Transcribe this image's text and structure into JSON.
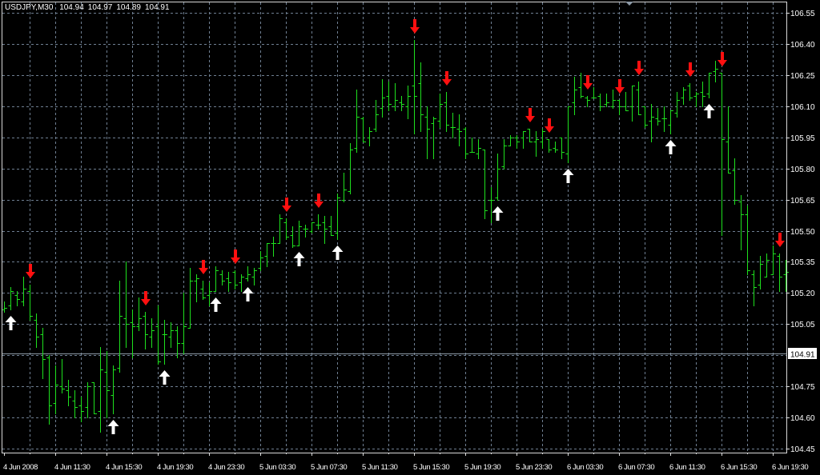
{
  "header": {
    "symbol": "USDJPY,M30",
    "open": "104.94",
    "high": "104.97",
    "low": "104.89",
    "close": "104.91"
  },
  "colors": {
    "background": "#000000",
    "grid": "#6f7f92",
    "bar": "#1ee01e",
    "sell_arrow": "#ff1010",
    "buy_arrow": "#ffffff",
    "current_price_line": "#8c99a6"
  },
  "chart_data": {
    "type": "ohlc",
    "title": "USDJPY,M30",
    "ylim": [
      104.45,
      106.55
    ],
    "grid": true,
    "current_price": 104.91,
    "current_price_label": "104.91",
    "price_ticks": [
      "106.55",
      "106.40",
      "106.25",
      "106.10",
      "105.95",
      "105.80",
      "105.65",
      "105.50",
      "105.35",
      "105.20",
      "105.05",
      "104.75",
      "104.60",
      "104.45"
    ],
    "time_labels": [
      "4 Jun 2008",
      "4 Jun 11:30",
      "4 Jun 15:30",
      "4 Jun 19:30",
      "4 Jun 23:30",
      "5 Jun 03:30",
      "5 Jun 07:30",
      "5 Jun 11:30",
      "5 Jun 15:30",
      "5 Jun 19:30",
      "5 Jun 23:30",
      "6 Jun 03:30",
      "6 Jun 07:30",
      "6 Jun 11:30",
      "6 Jun 15:30",
      "6 Jun 19:30"
    ],
    "bars_ohlc": [
      [
        105.12,
        105.16,
        105.11,
        105.13
      ],
      [
        105.14,
        105.23,
        105.12,
        105.21
      ],
      [
        105.19,
        105.21,
        105.14,
        105.17
      ],
      [
        105.16,
        105.28,
        105.14,
        105.22
      ],
      [
        105.21,
        105.24,
        105.07,
        105.09
      ],
      [
        105.07,
        105.1,
        104.94,
        104.99
      ],
      [
        105.0,
        105.03,
        104.79,
        104.88
      ],
      [
        104.89,
        104.9,
        104.57,
        104.66
      ],
      [
        104.67,
        104.85,
        104.62,
        104.76
      ],
      [
        104.75,
        104.88,
        104.72,
        104.74
      ],
      [
        104.73,
        104.78,
        104.66,
        104.7
      ],
      [
        104.68,
        104.73,
        104.6,
        104.65
      ],
      [
        104.66,
        104.7,
        104.58,
        104.63
      ],
      [
        104.65,
        104.77,
        104.6,
        104.75
      ],
      [
        104.77,
        104.77,
        104.62,
        104.62
      ],
      [
        104.63,
        104.94,
        104.53,
        104.83
      ],
      [
        104.82,
        104.92,
        104.6,
        104.73
      ],
      [
        104.71,
        104.85,
        104.62,
        104.83
      ],
      [
        104.84,
        105.26,
        104.82,
        105.09
      ],
      [
        105.08,
        105.35,
        104.94,
        105.05
      ],
      [
        105.06,
        105.12,
        104.89,
        105.04
      ],
      [
        105.04,
        105.18,
        105.02,
        105.08
      ],
      [
        105.09,
        105.11,
        104.93,
        105.0
      ],
      [
        104.99,
        105.08,
        104.94,
        105.02
      ],
      [
        105.04,
        105.14,
        104.86,
        104.87
      ],
      [
        105.0,
        105.07,
        104.86,
        105.0
      ],
      [
        104.99,
        105.06,
        104.94,
        105.02
      ],
      [
        105.02,
        105.04,
        104.89,
        104.96
      ],
      [
        104.96,
        105.2,
        104.91,
        105.04
      ],
      [
        105.03,
        105.32,
        105.03,
        105.26
      ],
      [
        105.26,
        105.29,
        105.16,
        105.27
      ],
      [
        105.22,
        105.26,
        105.17,
        105.18
      ],
      [
        105.19,
        105.25,
        105.14,
        105.21
      ],
      [
        105.21,
        105.33,
        105.21,
        105.31
      ],
      [
        105.29,
        105.31,
        105.24,
        105.26
      ],
      [
        105.27,
        105.3,
        105.21,
        105.25
      ],
      [
        105.3,
        105.31,
        105.22,
        105.24
      ],
      [
        105.25,
        105.29,
        105.21,
        105.28
      ],
      [
        105.27,
        105.33,
        105.26,
        105.29
      ],
      [
        105.28,
        105.32,
        105.24,
        105.31
      ],
      [
        105.32,
        105.4,
        105.31,
        105.37
      ],
      [
        105.38,
        105.44,
        105.33,
        105.44
      ],
      [
        105.44,
        105.47,
        105.38,
        105.44
      ],
      [
        105.44,
        105.58,
        105.44,
        105.56
      ],
      [
        105.54,
        105.56,
        105.46,
        105.47
      ],
      [
        105.48,
        105.52,
        105.42,
        105.43
      ],
      [
        105.43,
        105.55,
        105.43,
        105.52
      ],
      [
        105.51,
        105.53,
        105.47,
        105.51
      ],
      [
        105.5,
        105.54,
        105.49,
        105.54
      ],
      [
        105.53,
        105.58,
        105.51,
        105.53
      ],
      [
        105.54,
        105.57,
        105.44,
        105.51
      ],
      [
        105.52,
        105.57,
        105.48,
        105.48
      ],
      [
        105.49,
        105.68,
        105.46,
        105.66
      ],
      [
        105.65,
        105.78,
        105.64,
        105.7
      ],
      [
        105.69,
        105.92,
        105.68,
        105.89
      ],
      [
        105.9,
        106.18,
        105.88,
        106.05
      ],
      [
        106.04,
        106.05,
        105.93,
        105.93
      ],
      [
        105.95,
        106.0,
        105.91,
        105.98
      ],
      [
        105.99,
        106.13,
        105.98,
        106.06
      ],
      [
        106.09,
        106.23,
        106.05,
        106.14
      ],
      [
        106.15,
        106.22,
        106.08,
        106.11
      ],
      [
        106.1,
        106.21,
        106.08,
        106.13
      ],
      [
        106.12,
        106.15,
        106.08,
        106.11
      ],
      [
        106.1,
        106.2,
        106.04,
        106.15
      ],
      [
        106.2,
        106.42,
        105.97,
        106.15
      ],
      [
        106.21,
        106.31,
        105.98,
        106.06
      ],
      [
        106.05,
        106.1,
        105.85,
        105.99
      ],
      [
        106.02,
        106.05,
        105.85,
        106.04
      ],
      [
        106.03,
        106.16,
        106.0,
        106.11
      ],
      [
        106.12,
        106.17,
        105.98,
        106.01
      ],
      [
        106.0,
        106.07,
        105.95,
        106.0
      ],
      [
        105.99,
        106.06,
        105.91,
        105.98
      ],
      [
        105.99,
        106.0,
        105.85,
        105.87
      ],
      [
        105.88,
        105.95,
        105.88,
        105.88
      ],
      [
        105.87,
        105.94,
        105.85,
        105.9
      ],
      [
        105.89,
        105.89,
        105.56,
        105.6
      ],
      [
        105.65,
        105.71,
        105.54,
        105.65
      ],
      [
        105.66,
        105.87,
        105.65,
        105.8
      ],
      [
        105.81,
        105.94,
        105.8,
        105.91
      ],
      [
        105.91,
        105.96,
        105.91,
        105.95
      ],
      [
        105.95,
        105.96,
        105.9,
        105.93
      ],
      [
        105.95,
        105.98,
        105.9,
        105.98
      ],
      [
        105.99,
        105.99,
        105.93,
        105.93
      ],
      [
        105.93,
        105.98,
        105.86,
        105.94
      ],
      [
        105.93,
        105.99,
        105.9,
        105.98
      ],
      [
        105.94,
        105.94,
        105.88,
        105.89
      ],
      [
        105.9,
        105.93,
        105.88,
        105.89
      ],
      [
        105.95,
        105.95,
        105.85,
        105.88
      ],
      [
        105.87,
        106.1,
        105.83,
        106.1
      ],
      [
        106.12,
        106.24,
        106.06,
        106.18
      ],
      [
        106.19,
        106.26,
        106.14,
        106.15
      ],
      [
        106.14,
        106.15,
        106.1,
        106.13
      ],
      [
        106.14,
        106.19,
        106.14,
        106.14
      ],
      [
        106.15,
        106.16,
        106.08,
        106.1
      ],
      [
        106.11,
        106.16,
        106.1,
        106.12
      ],
      [
        106.1,
        106.18,
        106.09,
        106.13
      ],
      [
        106.13,
        106.13,
        106.06,
        106.1
      ],
      [
        106.1,
        106.17,
        106.08,
        106.08
      ],
      [
        106.1,
        106.2,
        106.03,
        106.2
      ],
      [
        106.18,
        106.22,
        106.06,
        106.06
      ],
      [
        106.1,
        106.1,
        106.0,
        106.01
      ],
      [
        106.03,
        106.11,
        105.93,
        106.05
      ],
      [
        106.04,
        106.09,
        106.01,
        106.03
      ],
      [
        106.04,
        106.1,
        105.98,
        106.04
      ],
      [
        106.01,
        106.08,
        105.97,
        106.08
      ],
      [
        106.07,
        106.17,
        106.05,
        106.13
      ],
      [
        106.14,
        106.19,
        106.11,
        106.18
      ],
      [
        106.2,
        106.21,
        106.13,
        106.14
      ],
      [
        106.15,
        106.17,
        106.1,
        106.16
      ],
      [
        106.17,
        106.22,
        106.1,
        106.15
      ],
      [
        106.16,
        106.26,
        106.14,
        106.26
      ],
      [
        106.27,
        106.32,
        106.22,
        106.28
      ],
      [
        106.26,
        106.26,
        105.48,
        105.94
      ],
      [
        105.93,
        106.1,
        105.78,
        105.78
      ],
      [
        105.79,
        105.85,
        105.63,
        105.65
      ],
      [
        105.64,
        105.67,
        105.41,
        105.58
      ],
      [
        105.58,
        105.62,
        105.29,
        105.31
      ],
      [
        105.29,
        105.31,
        105.14,
        105.23
      ],
      [
        105.24,
        105.38,
        105.22,
        105.34
      ],
      [
        105.28,
        105.39,
        105.28,
        105.36
      ],
      [
        105.29,
        105.43,
        105.29,
        105.39
      ],
      [
        105.38,
        105.39,
        105.21,
        105.28
      ],
      [
        105.29,
        105.36,
        105.21,
        105.3
      ]
    ],
    "sell_signal_bars": [
      4,
      22,
      31,
      36,
      44,
      49,
      64,
      69,
      82,
      85,
      91,
      96,
      99,
      107,
      112,
      121
    ],
    "buy_signal_bars": [
      1,
      17,
      25,
      33,
      38,
      46,
      52,
      77,
      88,
      104,
      110
    ]
  }
}
